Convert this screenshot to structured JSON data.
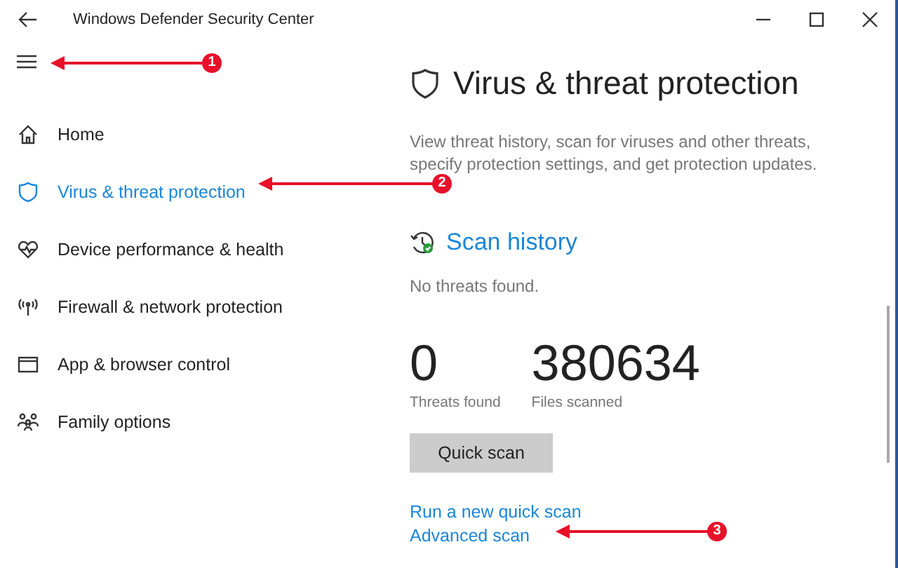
{
  "window": {
    "title": "Windows Defender Security Center"
  },
  "sidebar": {
    "items": [
      {
        "label": "Home",
        "kind": "home",
        "selected": false
      },
      {
        "label": "Virus & threat protection",
        "kind": "shield",
        "selected": true
      },
      {
        "label": "Device performance & health",
        "kind": "heart",
        "selected": false
      },
      {
        "label": "Firewall & network protection",
        "kind": "antenna",
        "selected": false
      },
      {
        "label": "App & browser control",
        "kind": "window",
        "selected": false
      },
      {
        "label": "Family options",
        "kind": "family",
        "selected": false
      }
    ]
  },
  "main": {
    "title": "Virus & threat protection",
    "description": "View threat history, scan for viruses and other threats, specify protection settings, and get protection updates.",
    "scan_history": {
      "title": "Scan history",
      "status": "No threats found.",
      "stats": [
        {
          "value": "0",
          "label": "Threats found"
        },
        {
          "value": "380634",
          "label": "Files scanned"
        }
      ],
      "button": "Quick scan",
      "links": [
        "Run a new quick scan",
        "Advanced scan"
      ]
    }
  },
  "annotations": [
    "1",
    "2",
    "3"
  ]
}
